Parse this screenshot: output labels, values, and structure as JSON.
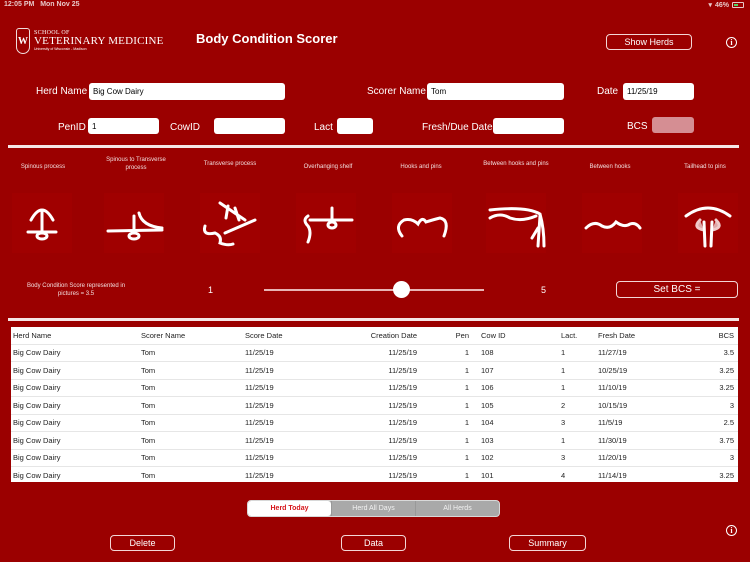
{
  "status_bar": {
    "time": "12:05 PM",
    "date": "Mon Nov 25",
    "battery": "46%",
    "wifi_icon": "wifi-icon",
    "battery_icon": "battery-icon"
  },
  "header": {
    "logo": {
      "crest_letter": "W",
      "line1": "SCHOOL OF",
      "line2": "VETERINARY MEDICINE",
      "line3": "University of Wisconsin - Madison"
    },
    "title": "Body Condition Scorer",
    "show_herds_label": "Show Herds",
    "info_icon": "info-icon"
  },
  "form": {
    "herd_name": {
      "label": "Herd Name",
      "value": "Big Cow Dairy"
    },
    "scorer_name": {
      "label": "Scorer Name",
      "value": "Tom"
    },
    "date": {
      "label": "Date",
      "value": "11/25/19"
    },
    "pen_id": {
      "label": "PenID",
      "value": "1"
    },
    "cow_id": {
      "label": "CowID",
      "value": ""
    },
    "lact": {
      "label": "Lact",
      "value": ""
    },
    "fresh_due_date": {
      "label": "Fresh/Due Date",
      "value": ""
    },
    "bcs": {
      "label": "BCS",
      "value": ""
    }
  },
  "pictures": [
    {
      "label": "Spinous process",
      "icon": "spinous-process-icon"
    },
    {
      "label": "Spinous to Transverse process",
      "icon": "spinous-to-transverse-icon"
    },
    {
      "label": "Transverse process",
      "icon": "transverse-process-icon"
    },
    {
      "label": "Overhanging shelf",
      "icon": "overhanging-shelf-icon"
    },
    {
      "label": "Hooks and pins",
      "icon": "hooks-and-pins-icon"
    },
    {
      "label": "Between hooks and pins",
      "icon": "between-hooks-and-pins-icon"
    },
    {
      "label": "Between hooks",
      "icon": "between-hooks-icon"
    },
    {
      "label": "Tailhead to pins",
      "icon": "tailhead-to-pins-icon"
    }
  ],
  "slider": {
    "caption": "Body Condition Score represented in pictures = 3.5",
    "min_label": "1",
    "max_label": "5",
    "min": 1,
    "max": 5,
    "value": 3.5,
    "set_bcs_label": "Set BCS ="
  },
  "table": {
    "columns": [
      "Herd Name",
      "Scorer Name",
      "Score Date",
      "Creation Date",
      "Pen",
      "Cow ID",
      "Lact.",
      "Fresh Date",
      "BCS"
    ],
    "rows": [
      [
        "Big Cow Dairy",
        "Tom",
        "11/25/19",
        "11/25/19",
        "1",
        "108",
        "1",
        "11/27/19",
        "3.5"
      ],
      [
        "Big Cow Dairy",
        "Tom",
        "11/25/19",
        "11/25/19",
        "1",
        "107",
        "1",
        "10/25/19",
        "3.25"
      ],
      [
        "Big Cow Dairy",
        "Tom",
        "11/25/19",
        "11/25/19",
        "1",
        "106",
        "1",
        "11/10/19",
        "3.25"
      ],
      [
        "Big Cow Dairy",
        "Tom",
        "11/25/19",
        "11/25/19",
        "1",
        "105",
        "2",
        "10/15/19",
        "3"
      ],
      [
        "Big Cow Dairy",
        "Tom",
        "11/25/19",
        "11/25/19",
        "1",
        "104",
        "3",
        "11/5/19",
        "2.5"
      ],
      [
        "Big Cow Dairy",
        "Tom",
        "11/25/19",
        "11/25/19",
        "1",
        "103",
        "1",
        "11/30/19",
        "3.75"
      ],
      [
        "Big Cow Dairy",
        "Tom",
        "11/25/19",
        "11/25/19",
        "1",
        "102",
        "3",
        "11/20/19",
        "3"
      ],
      [
        "Big Cow Dairy",
        "Tom",
        "11/25/19",
        "11/25/19",
        "1",
        "101",
        "4",
        "11/14/19",
        "3.25"
      ]
    ]
  },
  "segments": {
    "items": [
      "Herd Today",
      "Herd All Days",
      "All Herds"
    ],
    "selected": "Herd Today"
  },
  "footer": {
    "delete_label": "Delete",
    "data_label": "Data",
    "summary_label": "Summary",
    "info_icon": "info-icon"
  },
  "colors": {
    "background": "#9b0000",
    "accent_text": "#d6161b",
    "bcs_field": "#d58e93"
  }
}
